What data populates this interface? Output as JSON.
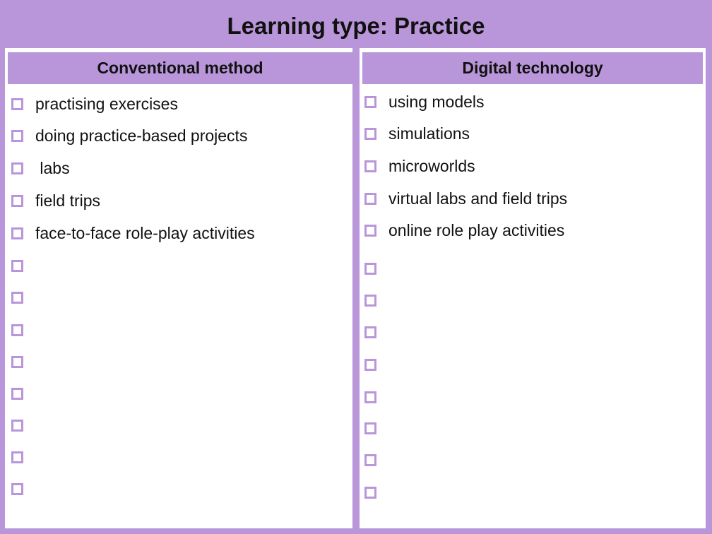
{
  "title": "Learning type: Practice",
  "columns": [
    {
      "header": "Conventional method",
      "items": [
        "practising exercises",
        "doing practice-based projects",
        " labs",
        "field trips",
        "face-to-face role-play activities",
        "",
        "",
        "",
        "",
        "",
        "",
        "",
        ""
      ]
    },
    {
      "header": "Digital technology",
      "items": [
        "using models",
        "simulations",
        "microworlds",
        "virtual labs and field trips",
        "online role play activities",
        "",
        "",
        "",
        "",
        "",
        "",
        "",
        ""
      ]
    }
  ],
  "colors": {
    "accent": "#b996d9",
    "text": "#111111"
  }
}
